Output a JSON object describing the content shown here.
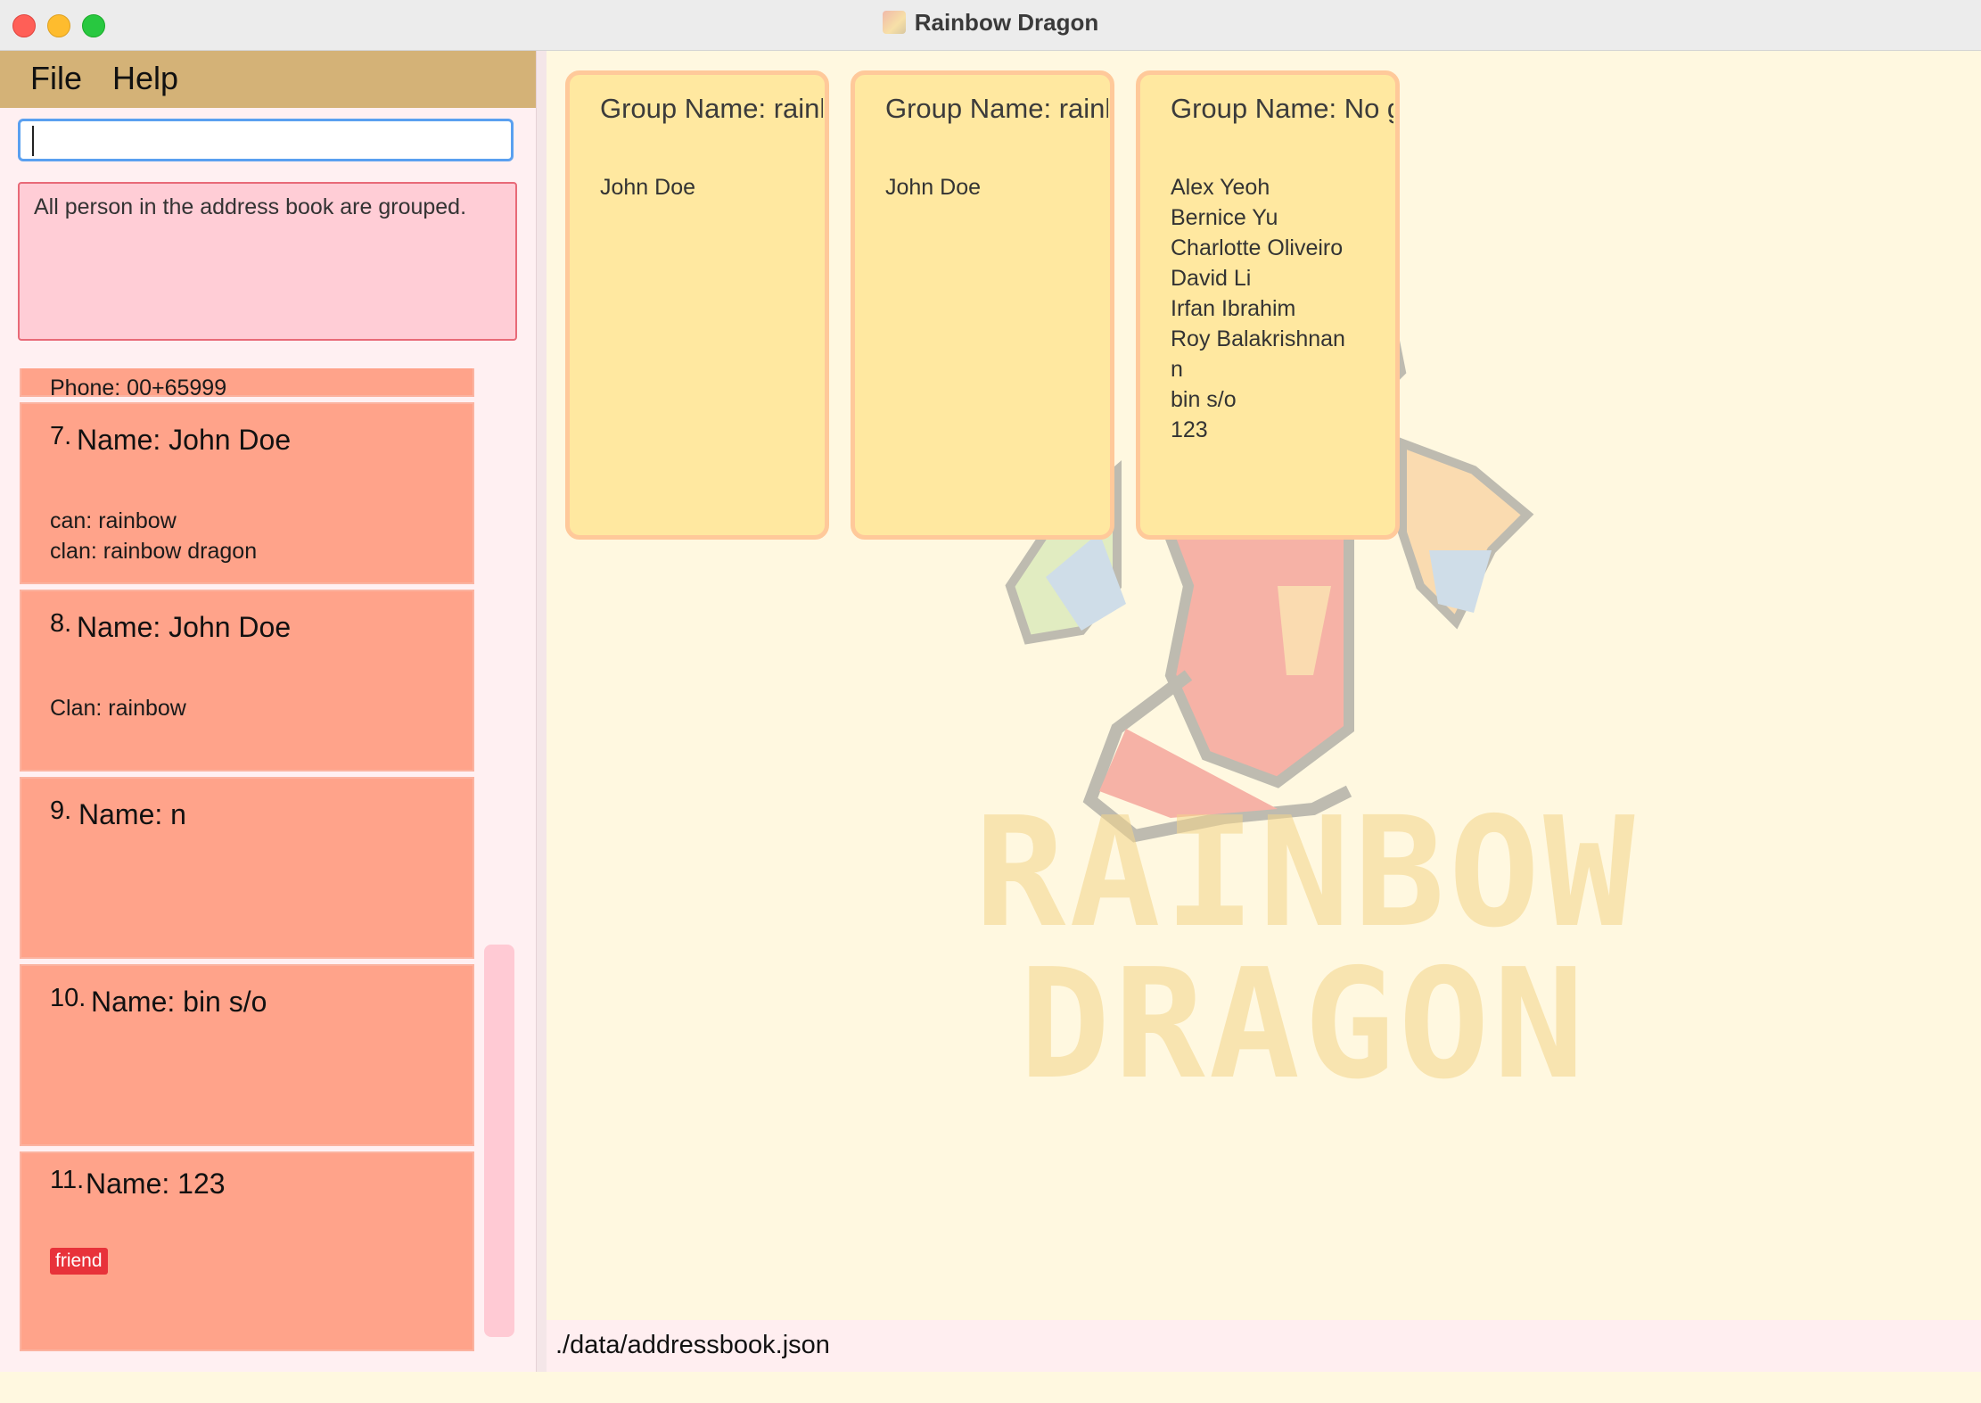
{
  "window": {
    "title": "Rainbow Dragon"
  },
  "menu": {
    "file": "File",
    "help": "Help"
  },
  "command": {
    "value": ""
  },
  "result": {
    "text": "All person in the address book are grouped."
  },
  "persons": {
    "partial_phone": "Phone: 00+65999",
    "items": [
      {
        "index": "7.",
        "name": "Name: John Doe",
        "lines": [
          "can: rainbow",
          "clan: rainbow dragon"
        ]
      },
      {
        "index": "8.",
        "name": "Name: John Doe",
        "lines": [
          "Clan: rainbow"
        ]
      },
      {
        "index": "9.",
        "name": "Name: n",
        "lines": []
      },
      {
        "index": "10.",
        "name": "Name: bin s/o",
        "lines": []
      },
      {
        "index": "11.",
        "name": "Name: 123",
        "lines": [],
        "tag": "friend"
      }
    ]
  },
  "groups": [
    {
      "title": "Group Name: rainbow",
      "members": [
        "John Doe"
      ]
    },
    {
      "title": "Group Name: rainbow dragon",
      "members": [
        "John Doe"
      ]
    },
    {
      "title": "Group Name: No group",
      "members": [
        "Alex Yeoh",
        "Bernice Yu",
        "Charlotte Oliveiro",
        "David Li",
        "Irfan Ibrahim",
        "Roy Balakrishnan",
        "n",
        "bin s/o",
        "123"
      ]
    }
  ],
  "background": {
    "line1": "RAINBOW",
    "line2": "DRAGON"
  },
  "status": {
    "path": "./data/addressbook.json"
  },
  "colors": {
    "menubar": "#d4b277",
    "person_card": "#ffa38a",
    "group_card": "#ffe8a0",
    "tag": "#e8323a"
  }
}
